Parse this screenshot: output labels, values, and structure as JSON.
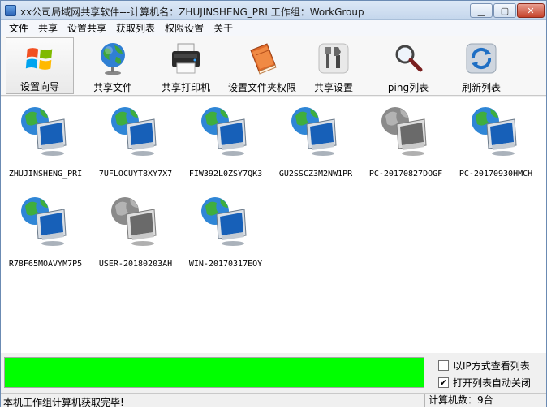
{
  "window": {
    "title": "xx公司局域网共享软件---计算机名：ZHUJINSHENG_PRI  工作组：WorkGroup"
  },
  "menu": [
    "文件",
    "共享",
    "设置共享",
    "获取列表",
    "权限设置",
    "关于"
  ],
  "toolbar": [
    {
      "label": "设置向导",
      "icon": "windows-logo-icon"
    },
    {
      "label": "共享文件",
      "icon": "globe-icon"
    },
    {
      "label": "共享打印机",
      "icon": "printer-icon"
    },
    {
      "label": "设置文件夹权限",
      "icon": "folder-book-icon"
    },
    {
      "label": "共享设置",
      "icon": "tools-icon"
    },
    {
      "label": "ping列表",
      "icon": "magnifier-icon"
    },
    {
      "label": "刷新列表",
      "icon": "refresh-icon"
    }
  ],
  "computers": [
    {
      "name": "ZHUJINSHENG_PRI",
      "online": true
    },
    {
      "name": "7UFLOCUYT8XY7X7",
      "online": true
    },
    {
      "name": "FIW392L0ZSY7QK3",
      "online": true
    },
    {
      "name": "GU2SSCZ3M2NW1PR",
      "online": true
    },
    {
      "name": "PC-20170827DOGF",
      "online": false
    },
    {
      "name": "PC-20170930HMCH",
      "online": true
    },
    {
      "name": "R78F65MOAVYM7P5",
      "online": true
    },
    {
      "name": "USER-20180203AH",
      "online": false
    },
    {
      "name": "WIN-20170317EOY",
      "online": true
    }
  ],
  "progress": {
    "percent": 100,
    "color": "#00ff00"
  },
  "options": {
    "view_by_ip": {
      "label": "以IP方式查看列表",
      "checked": false
    },
    "auto_close": {
      "label": "打开列表自动关闭",
      "checked": true
    }
  },
  "status": {
    "message": "本机工作组计算机获取完毕!",
    "count": "计算机数：9台"
  }
}
